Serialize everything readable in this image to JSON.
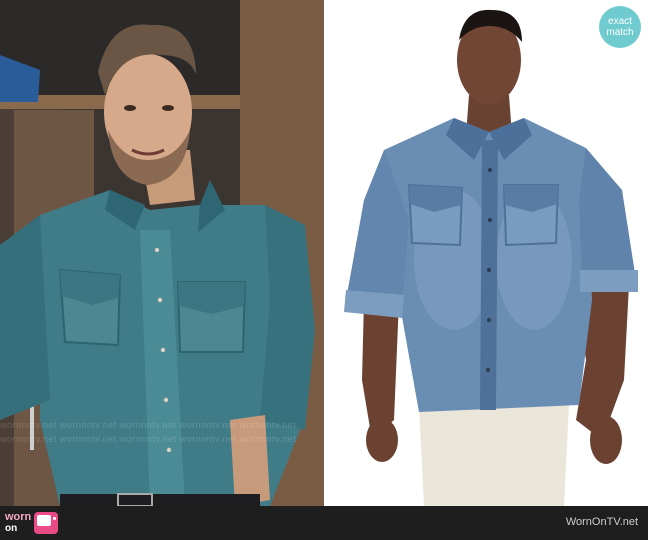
{
  "badge": {
    "line1": "exact",
    "line2": "match"
  },
  "watermark": {
    "row1": "wornontv.net   wornontv.net   wornontv.net   wornontv.net   wornontv.net",
    "row2": "wornontv.net   wornontv.net   wornontv.net   wornontv.net   wornontv.net"
  },
  "footer": {
    "logo_word1": "worn",
    "logo_word2": "on",
    "site_name": "WornOnTV.net"
  },
  "colors": {
    "badge_bg": "#6fcbcf",
    "footer_bg": "#1e1e1e",
    "logo_pink": "#e84b86",
    "denim_light": "#5b7fa6",
    "denim_teal": "#3d7a86"
  }
}
